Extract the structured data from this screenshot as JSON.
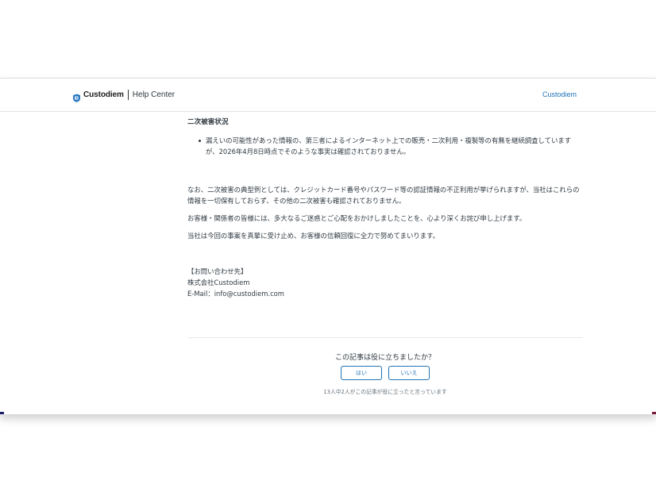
{
  "header": {
    "brand": "Custodiem",
    "help_center": "Help Center",
    "nav_link": "Custodiem",
    "brand_color": "#1f73b7"
  },
  "article": {
    "section_title": "二次被害状況",
    "bullets": [
      "漏えいの可能性があった情報の、第三者によるインターネット上での販売・二次利用・複製等の有無を継続調査していますが、2026年4月8日時点でそのような事実は確認されておりません。"
    ],
    "paragraphs": [
      "なお、二次被害の典型例としては、クレジットカード番号やパスワード等の認証情報の不正利用が挙げられますが、当社はこれらの情報を一切保有しておらず、その他の二次被害も確認されておりません。",
      "お客様・関係者の皆様には、多大なるご迷惑とご心配をおかけしましたことを、心より深くお詫び申し上げます。",
      "当社は今回の事案を真摯に受け止め、お客様の信頼回復に全力で努めてまいります。"
    ],
    "contact": {
      "heading": "【お問い合わせ先】",
      "company": "株式会社Custodiem",
      "email": "E-Mail：info@custodiem.com"
    }
  },
  "vote": {
    "question": "この記事は役に立ちましたか？",
    "yes_label": "はい",
    "no_label": "いいえ",
    "count_text": "13人中2人がこの記事が役に立ったと言っています"
  }
}
